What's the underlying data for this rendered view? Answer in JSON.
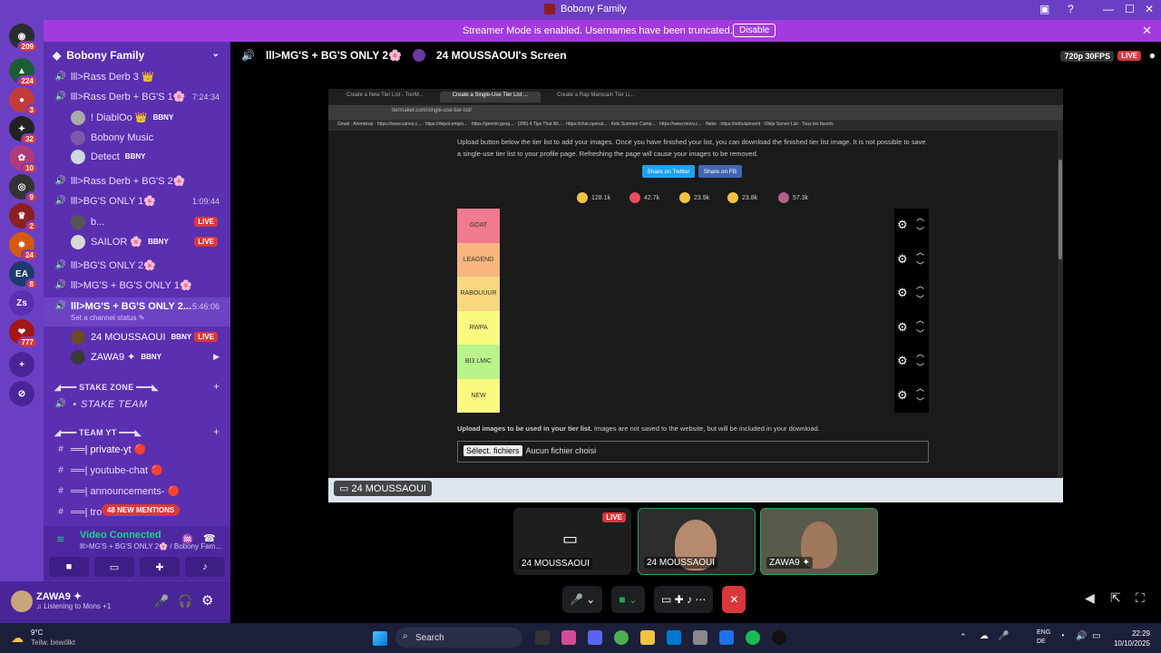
{
  "window": {
    "title": "Bobony Family"
  },
  "banner": {
    "message": "Streamer Mode is enabled. Usernames have been truncated.",
    "disable": "Disable"
  },
  "servers": [
    {
      "badge": "209"
    },
    {
      "badge": "224"
    },
    {
      "badge": "3"
    },
    {
      "badge": "32"
    },
    {
      "badge": "10"
    },
    {
      "badge": "9"
    },
    {
      "badge": "2"
    },
    {
      "badge": "24"
    },
    {
      "badge": "8"
    },
    {
      "label": "Zs"
    },
    {
      "badge": "777"
    }
  ],
  "sidebar": {
    "guild": "Bobony Family",
    "channels": [
      {
        "name": "lll>Rass Derb 3 👑"
      },
      {
        "name": "lll>Rass Derb + BG'S 1🌸",
        "time": "7:24:34"
      },
      {
        "user": "! DiablOo 👑",
        "tag": "BBNY"
      },
      {
        "user": "Bobony Music"
      },
      {
        "user": "Detect",
        "tag": "BBNY"
      },
      {
        "name": "lll>Rass Derb + BG'S 2🌸"
      },
      {
        "name": "lll>BG'S ONLY 1🌸",
        "time": "1:09:44"
      },
      {
        "user": "b...",
        "live": "LIVE"
      },
      {
        "user": "SAILOR 🌸",
        "tag": "BBNY",
        "live": "LIVE"
      },
      {
        "name": "lll>BG'S ONLY 2🌸"
      },
      {
        "name": "lll>MG'S + BG'S ONLY 1🌸"
      },
      {
        "name": "lll>MG'S + BG'S ONLY 2...",
        "time": "5:46:06",
        "status": "Set a channel status ✎"
      },
      {
        "user": "24 MOUSSAOUI",
        "tag": "BBNY",
        "live": "LIVE"
      },
      {
        "user": "ZAWA9 ✦",
        "tag": "BBNY"
      }
    ],
    "categories": [
      "◢━━━ STAKE ZONE ━━━◣",
      "◢━━━ TEAM YT ━━━◣"
    ],
    "stake_team": "⋆ STAKE TEAM",
    "text_channels": [
      "══| private-yt 🔴",
      "══| youtube-chat 🔴",
      "══| announcements- 🔴",
      "══| tro"
    ],
    "mentions": "48 NEW MENTIONS"
  },
  "voice": {
    "status": "Video Connected",
    "channel": "lll>MG'S + BG'S ONLY 2🌸 / Bobony Fam..."
  },
  "user": {
    "name": "ZAWA9 ✦",
    "activity": "♫ Listening to Mons +1"
  },
  "main": {
    "channel": "lll>MG'S + BG'S ONLY 2🌸",
    "screen_owner": "24 MOUSSAOUI's Screen",
    "quality": "720p 30FPS",
    "live": "LIVE",
    "screen_label": "24 MOUSSAOUI"
  },
  "browser": {
    "tabs": [
      "Create a New Tier List - TierM...",
      "Create a Single-Use Tier List ...",
      "Create a Rap Marocain Tier Li..."
    ],
    "url": "tiermaker.com/single-use-tier-list/",
    "bookmarks": "Gmail  ·  Animekop  ·  https://www.canva.c...  ·  https://depot.emplo...  ·  https://gemini.goog...  ·  (286) 4 Tips That Wi...  ·  https://chat.openai...  ·  Kids Summer Camp...  ·  https://www.movv.c...  ·  Nebe  ·  https://nebula/event  ·  Obtje Server List  ·  Tous les favoris"
  },
  "tierpage": {
    "intro": "Upload button below the tier list to add your images. Once you have finished your list, you can download the finished tier list image. It is not possible to save a single-use tier list to your profile page. Refreshing the page will cause your images to be removed.",
    "share_twitter": "Share on Twitter",
    "share_fb": "Share on FB",
    "reactions": [
      "128.1k",
      "42.7k",
      "23.9k",
      "23.8k",
      "57.3k"
    ],
    "tiers": [
      {
        "label": "GOAT",
        "color": "#f07a8f"
      },
      {
        "label": "LEAGEND",
        "color": "#f7b67e"
      },
      {
        "label": "RABOUUUR",
        "color": "#f7d87e"
      },
      {
        "label": "RWPA",
        "color": "#fafa80"
      },
      {
        "label": "BI3 LMIC",
        "color": "#b8f48a"
      },
      {
        "label": "NEW",
        "color": "#fafa80"
      }
    ],
    "upload_bold": "Upload images to be used in your tier list.",
    "upload_rest": " Images are not saved to the website, but will be included in your download.",
    "file_button": "Sélect. fichiers",
    "file_none": "Aucun fichier choisi"
  },
  "tiles": [
    {
      "name": "24 MOUSSAOUI",
      "live": "LIVE"
    },
    {
      "name": "24 MOUSSAOUI"
    },
    {
      "name": "ZAWA9 ✦"
    }
  ],
  "taskbar": {
    "temp": "9°C",
    "weather": "Teilw. bewölkt",
    "search": "Search",
    "lang1": "ENG",
    "lang2": "DE",
    "time": "22:29",
    "date": "10/10/2025"
  },
  "colors": {
    "brand": "#6b3fc4",
    "sidebar": "#5a2fb0",
    "live": "#da373c",
    "connected": "#23d18b"
  }
}
